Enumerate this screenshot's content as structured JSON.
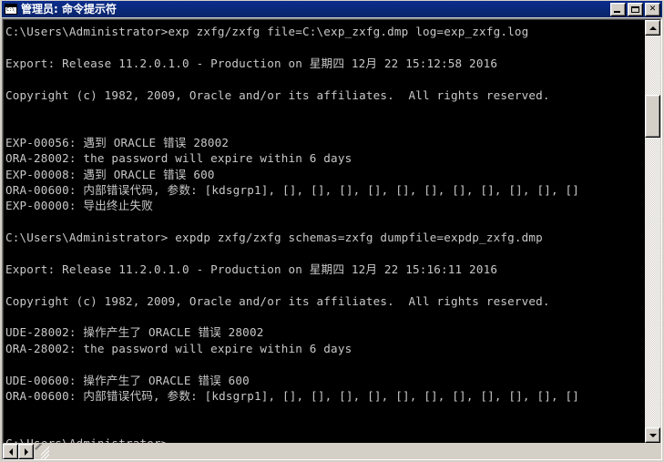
{
  "window": {
    "title": "管理员: 命令提示符",
    "icon": "console-icon",
    "controls": {
      "minimize": "minimize-button",
      "maximize": "maximize-button",
      "close": "✕"
    }
  },
  "console": {
    "background_color": "#000000",
    "text_color": "#c8c8c8",
    "lines": [
      "C:\\Users\\Administrator>exp zxfg/zxfg file=C:\\exp_zxfg.dmp log=exp_zxfg.log",
      "",
      "Export: Release 11.2.0.1.0 - Production on 星期四 12月 22 15:12:58 2016",
      "",
      "Copyright (c) 1982, 2009, Oracle and/or its affiliates.  All rights reserved.",
      "",
      "",
      "EXP-00056: 遇到 ORACLE 错误 28002",
      "ORA-28002: the password will expire within 6 days",
      "EXP-00008: 遇到 ORACLE 错误 600",
      "ORA-00600: 内部错误代码, 参数: [kdsgrp1], [], [], [], [], [], [], [], [], [], [], []",
      "EXP-00000: 导出终止失败",
      "",
      "C:\\Users\\Administrator> expdp zxfg/zxfg schemas=zxfg dumpfile=expdp_zxfg.dmp",
      "",
      "Export: Release 11.2.0.1.0 - Production on 星期四 12月 22 15:16:11 2016",
      "",
      "Copyright (c) 1982, 2009, Oracle and/or its affiliates.  All rights reserved.",
      "",
      "UDE-28002: 操作产生了 ORACLE 错误 28002",
      "ORA-28002: the password will expire within 6 days",
      "",
      "UDE-00600: 操作产生了 ORACLE 错误 600",
      "ORA-00600: 内部错误代码, 参数: [kdsgrp1], [], [], [], [], [], [], [], [], [], [], []",
      "",
      "",
      "C:\\Users\\Administrator>"
    ],
    "cursor_line_index": 26
  },
  "scrollbars": {
    "vertical": {
      "up_arrow": "scroll-up-arrow",
      "down_arrow": "scroll-down-arrow",
      "thumb_top_pct": 15,
      "thumb_height_pct": 11
    },
    "horizontal": {
      "left_arrow": "scroll-left-arrow",
      "right_arrow": "scroll-right-arrow",
      "thumb_left_pct": 0,
      "thumb_width_pct": 89
    }
  }
}
